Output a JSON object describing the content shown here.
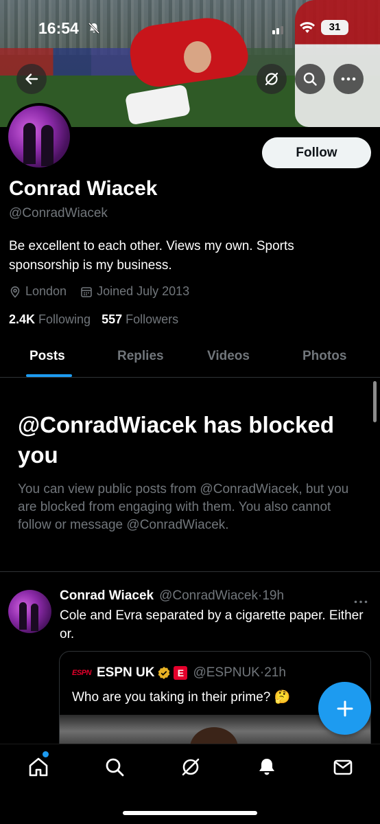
{
  "status_bar": {
    "time": "16:54",
    "battery": "31"
  },
  "profile": {
    "name": "Conrad Wiacek",
    "handle": "@ConradWiacek",
    "bio": "Be excellent to each other. Views my own. Sports sponsorship is my business.",
    "location": "London",
    "joined": "Joined July 2013",
    "following_count": "2.4K",
    "following_label": "Following",
    "followers_count": "557",
    "followers_label": "Followers",
    "follow_label": "Follow"
  },
  "tabs": [
    {
      "label": "Posts",
      "active": true
    },
    {
      "label": "Replies",
      "active": false
    },
    {
      "label": "Videos",
      "active": false
    },
    {
      "label": "Photos",
      "active": false
    }
  ],
  "blocked": {
    "title": "@ConradWiacek has blocked you",
    "description": "You can view public posts from @ConradWiacek, but you are blocked from engaging with them. You also cannot follow or message @ConradWiacek."
  },
  "post": {
    "author_name": "Conrad Wiacek",
    "author_handle": "@ConradWiacek",
    "separator": "·",
    "time": "19h",
    "text": "Cole and Evra separated by a cigarette paper. Either or.",
    "quote": {
      "logo_text": "ESPN",
      "author_name": "ESPN UK",
      "badge_letter": "E",
      "author_handle": "@ESPNUK",
      "separator": "·",
      "time": "21h",
      "text": "Who are you taking in their prime? 🤔"
    }
  },
  "nav": {
    "items": [
      "home-icon",
      "search-icon",
      "grok-icon",
      "notifications-icon",
      "messages-icon"
    ]
  },
  "colors": {
    "accent": "#1d9bf0",
    "background": "#000000",
    "secondary_text": "#71767b",
    "border": "#2f3336"
  }
}
